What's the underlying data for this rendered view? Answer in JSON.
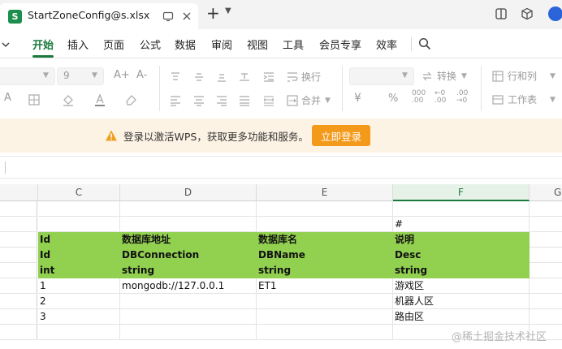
{
  "window": {
    "tab_title": "StartZoneConfig@s.xlsx",
    "app_badge": "S"
  },
  "menu": {
    "items": [
      "开始",
      "插入",
      "页面",
      "公式",
      "数据",
      "审阅",
      "视图",
      "工具",
      "会员专享",
      "效率"
    ],
    "active_index": 0
  },
  "ribbon": {
    "font_size": "9",
    "wrap_label": "换行",
    "merge_label": "合并",
    "convert_label": "转换",
    "rows_cols_label": "行和列",
    "worksheet_label": "工作表",
    "font_size_up": "A+",
    "font_size_down": "A-"
  },
  "banner": {
    "message": "登录以激活WPS，获取更多功能和服务。",
    "button_label": "立即登录",
    "accent_color": "#f39a1b",
    "background_color": "#fdf3e5"
  },
  "formula_bar": {
    "value": ""
  },
  "sheet": {
    "columns": [
      "C",
      "D",
      "E",
      "F",
      "G"
    ],
    "selected_column": "F",
    "header_fill_color": "#92d050",
    "rows": [
      {
        "cells": [
          "",
          "",
          "",
          ""
        ],
        "green": false
      },
      {
        "cells": [
          "",
          "",
          "",
          "#"
        ],
        "green": false
      },
      {
        "cells": [
          "Id",
          "数据库地址",
          "数据库名",
          "说明"
        ],
        "green": true
      },
      {
        "cells": [
          "Id",
          "DBConnection",
          "DBName",
          "Desc"
        ],
        "green": true
      },
      {
        "cells": [
          "int",
          "string",
          "string",
          "string"
        ],
        "green": true
      },
      {
        "cells": [
          "1",
          "mongodb://127.0.0.1",
          "ET1",
          "游戏区"
        ],
        "green": false
      },
      {
        "cells": [
          "2",
          "",
          "",
          "机器人区"
        ],
        "green": false
      },
      {
        "cells": [
          "3",
          "",
          "",
          "路由区"
        ],
        "green": false
      },
      {
        "cells": [
          "",
          "",
          "",
          ""
        ],
        "green": false
      }
    ]
  },
  "watermark": "@稀土掘金技术社区"
}
